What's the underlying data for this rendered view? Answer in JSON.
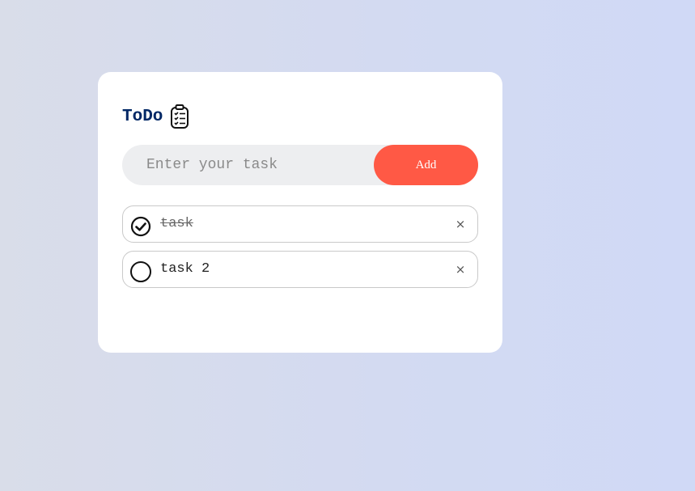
{
  "app": {
    "title": "ToDo"
  },
  "input": {
    "value": "",
    "placeholder": "Enter your task",
    "add_label": "Add"
  },
  "tasks": [
    {
      "label": "task",
      "done": true,
      "remove_label": "×"
    },
    {
      "label": "task 2",
      "done": false,
      "remove_label": "×"
    }
  ],
  "colors": {
    "accent": "#ff5945",
    "title": "#002765",
    "input_bg": "#edeef0"
  },
  "icons": {
    "title": "clipboard-checklist-icon",
    "checked": "check-circle-icon",
    "unchecked": "empty-circle-icon",
    "remove": "close-icon"
  }
}
